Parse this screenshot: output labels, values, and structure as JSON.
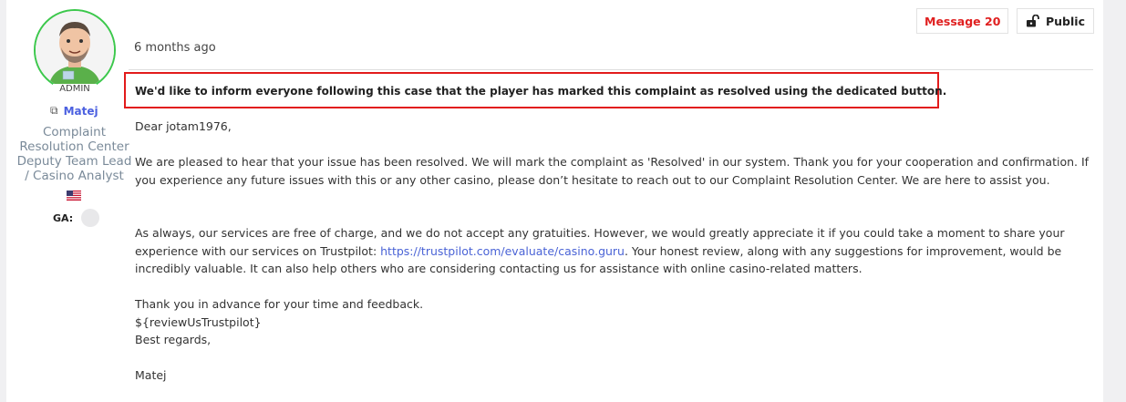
{
  "author": {
    "admin_label": "ADMIN",
    "name": "Matej",
    "role_lines": [
      "Complaint",
      "Resolution Center",
      "Deputy Team Lead",
      "/ Casino Analyst"
    ],
    "country_flag": "us-flag-icon",
    "ga_label": "GA:"
  },
  "message": {
    "timestamp": "6 months ago",
    "message_label": "Message 20",
    "visibility_label": "Public",
    "highlight": "We'd like to inform everyone following this case that the player has marked this complaint as resolved using the dedicated button.",
    "greeting": "Dear jotam1976,",
    "para1": "We are pleased to hear that your issue has been resolved. We will mark the complaint as 'Resolved' in our system. Thank you for your cooperation and confirmation. If you experience any future issues with this or any other casino, please don’t hesitate to reach out to our Complaint Resolution Center. We are here to assist you.",
    "para2_before_link": "As always, our services are free of charge, and we do not accept any gratuities. However, we would greatly appreciate it if you could take a moment to share your experience with our services on Trustpilot: ",
    "para2_link": "https://trustpilot.com/evaluate/casino.guru",
    "para2_after_link": ". Your honest review, along with any suggestions for improvement, would be incredibly valuable. It can also help others who are considering contacting us for assistance with online casino-related matters.",
    "thanks": "Thank you in advance for your time and feedback.",
    "placeholder": "${reviewUsTrustpilot}",
    "closing": "Best regards,",
    "signature": "Matej"
  },
  "colors": {
    "accent_red": "#e21b1b",
    "link_blue": "#4a63d6",
    "avatar_ring": "#3cc84c"
  }
}
